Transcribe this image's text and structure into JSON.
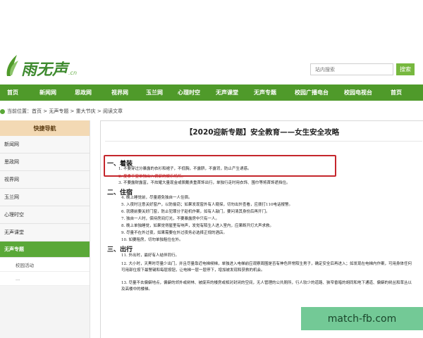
{
  "site": {
    "logo_text": "雨无声",
    "logo_sub": ".cn"
  },
  "search": {
    "placeholder": "站内搜索",
    "button_label": "搜索"
  },
  "nav": {
    "items": [
      "首页",
      "新闻网",
      "思政网",
      "视界网",
      "玉兰网",
      "心理时空",
      "无声课堂",
      "无声专题",
      "校园广播电台",
      "校园电视台",
      "首页"
    ]
  },
  "breadcrumb": "当前位置：首页 > 无声专题 > 重大节庆 > 阅读文章",
  "sidebar": {
    "title": "快捷导航",
    "items": [
      "新闻网",
      "思政网",
      "视界网",
      "玉兰网",
      "心理时空",
      "无声课堂"
    ],
    "active": "无声专题",
    "subitems": [
      "校园活动",
      "..."
    ]
  },
  "article": {
    "title": "【2020迎新专题】安全教育——女生安全攻略",
    "section1": {
      "heading": "一、着装",
      "lines": [
        "1. 不要穿过分暴露的衣衫和裙子，不低胸，不露脐，不露背，防止产生诱惑。",
        "2. 夏季不宜单独出入偏僻的娱乐场所。",
        "3. 不要露财露富，不炫耀大量现金或佩戴贵重首饰出行，单独行走时用衣饰、围巾等将首饰遮挡住。"
      ]
    },
    "section2": {
      "heading": "二、住宿",
      "lines": [
        "4. 晚上睡觉前，尽量避免独自一人住宿。",
        "5. 入夜时注意关好窗户，以防偷窃；如果发现窗外有人窥探，切勿出外查看，应拨打110电话报警。",
        "6. 就寝前要关好门窗，防止犯罪分子趁机作案，如有人敲门，要问清其身份后再开门。",
        "7. 独自一人时，保持房间灯光，不要暴露房中只有一人。",
        "8. 晚上单独睡觉，如果觉得屋里有响声，发觉有陌生人进入室内，应果断开灯大声求救。",
        "9. 尽量不在外过夜，如果需要在外过夜务必选择正规的酒店。",
        "10. 如要租房，切勿单独租住在外。"
      ]
    },
    "section3": {
      "heading": "三、出行",
      "lines": [
        "11. 外出时，最好有人结伴同行。",
        "12. 大小时，天黑时尽量少出门，并且尽量靠近电梯候梯，单独进入电梯前应观察周围是否有神色异常陌生男子，确定安全后再进入；如发现在电梯内作案，可用身体任何可用部位按下最警键和每层按钮，让电梯一层一层停下，增加被发现和获救的机会。",
        "13. 尽量不去偏僻地点，偏僻的郊外或树林、被废弃的楼房或相对封闭的空间，无人管理的公共厕所，行人较少的道路、狭窄昏暗的胡同和地下通道、偏僻的树丛和草丛以及高楼中的楼梯。"
      ]
    }
  },
  "watermark": "match-fb.com"
}
